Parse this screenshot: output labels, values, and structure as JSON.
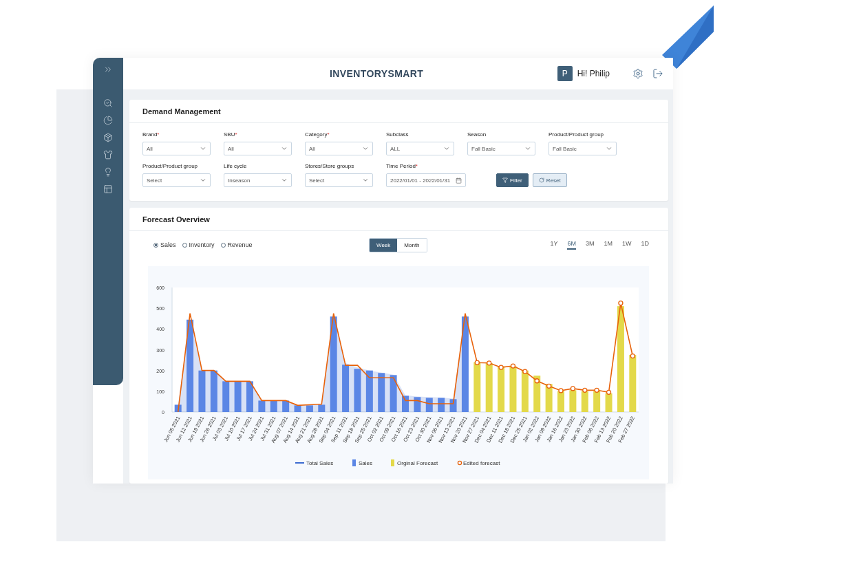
{
  "header": {
    "title": "INVENTORYSMART",
    "avatar": "P",
    "greeting": "Hi! Philip"
  },
  "demand": {
    "title": "Demand Management",
    "filters": [
      {
        "label": "Brand",
        "required_mark": "*",
        "value": "All",
        "kind": "select"
      },
      {
        "label": "SBU",
        "required_mark": "*",
        "value": "All",
        "kind": "select"
      },
      {
        "label": "Category",
        "required_mark": "*",
        "value": "All",
        "kind": "select"
      },
      {
        "label": "Subclass",
        "value": "ALL",
        "kind": "select"
      },
      {
        "label": "Season",
        "value": "Fall Basic",
        "kind": "select"
      },
      {
        "label": "Product/Product group",
        "value": "Fall Basic",
        "kind": "select"
      },
      {
        "label": "Product/Product group",
        "value": "Select",
        "kind": "select"
      },
      {
        "label": "Life cycle",
        "value": "Inseason",
        "kind": "select"
      },
      {
        "label": "Stores/Store groups",
        "value": "Select",
        "kind": "select"
      },
      {
        "label": "Time Period",
        "required_mark": "*",
        "value": "2022/01/01 - 2022/01/31",
        "kind": "date"
      }
    ],
    "buttons": [
      {
        "label": "Filter",
        "kind": "filter"
      },
      {
        "label": "Reset",
        "kind": "reset"
      }
    ]
  },
  "forecast": {
    "title": "Forecast Overview",
    "metrics": [
      {
        "label": "Sales",
        "selected": true
      },
      {
        "label": "Inventory",
        "selected": false
      },
      {
        "label": "Revenue",
        "selected": false
      }
    ],
    "granularity": [
      {
        "label": "Week",
        "selected": true
      },
      {
        "label": "Month",
        "selected": false
      }
    ],
    "ranges": [
      {
        "label": "1Y",
        "selected": false
      },
      {
        "label": "6M",
        "selected": true
      },
      {
        "label": "3M",
        "selected": false
      },
      {
        "label": "1M",
        "selected": false
      },
      {
        "label": "1W",
        "selected": false
      },
      {
        "label": "1D",
        "selected": false
      }
    ],
    "chart_data": {
      "type": "bar",
      "legend": "bottom",
      "ylim": [
        0,
        600
      ],
      "yticks": [
        0,
        100,
        200,
        300,
        400,
        500,
        600
      ],
      "categories": [
        "Jun 05 2021",
        "Jun 12 2021",
        "Jun 19 2021",
        "Jun 26 2021",
        "Jul 03 2021",
        "Jul 10 2021",
        "Jul 17 2021",
        "Jul 24 2021",
        "Jul 31 2021",
        "Aug 07 2021",
        "Aug 14 2021",
        "Aug 21 2021",
        "Aug 28 2021",
        "Sep 04 2021",
        "Sep 11 2021",
        "Sep 18 2021",
        "Sep 25 2021",
        "Oct 02 2021",
        "Oct 09 2021",
        "Oct 16 2021",
        "Oct 23 2021",
        "Oct 30 2021",
        "Nov 06 2021",
        "Nov 13 2021",
        "Nov 20 2021",
        "Nov 27 2021",
        "Dec 04 2021",
        "Dec 11 2021",
        "Dec 18 2021",
        "Dec 25 2021",
        "Jan 02 2022",
        "Jan 09 2022",
        "Jan 16 2022",
        "Jan 23 2022",
        "Jan 30 2022",
        "Feb 06 2022",
        "Feb 13 2022",
        "Feb 20 2022",
        "Feb 27 2022"
      ],
      "series": [
        {
          "name": "Total Sales",
          "type": "area",
          "color": "#3b6bd0",
          "values": [
            35,
            445,
            200,
            200,
            148,
            148,
            148,
            55,
            55,
            55,
            32,
            32,
            35,
            460,
            235,
            215,
            200,
            190,
            180,
            80,
            75,
            72,
            70,
            65,
            460,
            null,
            null,
            null,
            null,
            null,
            null,
            null,
            null,
            null,
            null,
            null,
            null,
            null,
            null
          ]
        },
        {
          "name": "Sales",
          "type": "bar",
          "color": "#5b86e5",
          "values": [
            35,
            445,
            200,
            200,
            148,
            148,
            148,
            55,
            55,
            55,
            32,
            32,
            35,
            460,
            228,
            208,
            200,
            188,
            178,
            78,
            72,
            68,
            68,
            62,
            460,
            null,
            null,
            null,
            null,
            null,
            null,
            null,
            null,
            null,
            null,
            null,
            null,
            null,
            null
          ]
        },
        {
          "name": "Orginal Forecast",
          "type": "bar",
          "color": "#e3d94a",
          "values": [
            null,
            null,
            null,
            null,
            null,
            null,
            null,
            null,
            null,
            null,
            null,
            null,
            null,
            null,
            null,
            null,
            null,
            null,
            null,
            null,
            null,
            null,
            null,
            null,
            null,
            240,
            235,
            220,
            220,
            200,
            175,
            135,
            100,
            105,
            100,
            100,
            90,
            510,
            275
          ]
        },
        {
          "name": "Edited forecast",
          "type": "line",
          "color": "#e8620a",
          "values": [
            0,
            475,
            200,
            200,
            148,
            148,
            148,
            55,
            55,
            55,
            32,
            35,
            38,
            475,
            225,
            225,
            165,
            165,
            165,
            55,
            55,
            40,
            40,
            40,
            475,
            238,
            236,
            215,
            222,
            195,
            150,
            125,
            103,
            113,
            105,
            105,
            95,
            525,
            270
          ]
        }
      ]
    }
  }
}
